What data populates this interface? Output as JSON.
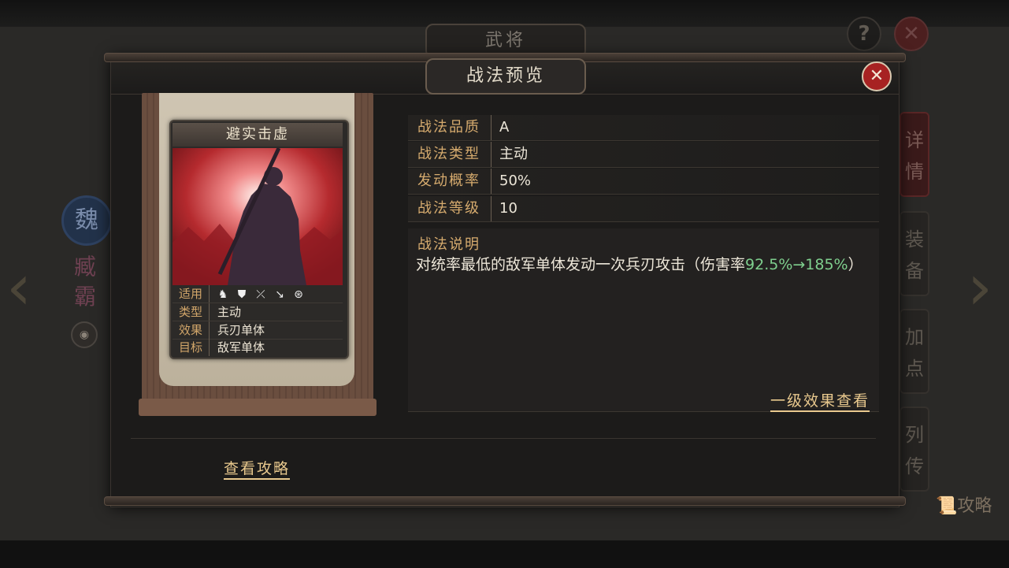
{
  "background": {
    "title": "武将",
    "help_label": "?",
    "close_label": "✕",
    "faction": "魏",
    "hero_name": "臧霸",
    "side_tabs": [
      "详情",
      "装备",
      "加点",
      "列传"
    ],
    "guide_label": "攻略"
  },
  "modal": {
    "title": "战法预览",
    "close_label": "✕",
    "card": {
      "name": "避实击虚",
      "rows": [
        {
          "key": "适用",
          "value": ""
        },
        {
          "key": "类型",
          "value": "主动"
        },
        {
          "key": "效果",
          "value": "兵刃单体"
        },
        {
          "key": "目标",
          "value": "敌军单体"
        }
      ],
      "unit_icons": [
        "cavalry-icon",
        "shield-icon",
        "bow-icon",
        "spear-icon",
        "siege-icon"
      ]
    },
    "attributes": [
      {
        "key": "战法品质",
        "value": "A"
      },
      {
        "key": "战法类型",
        "value": "主动"
      },
      {
        "key": "发动概率",
        "value": "50%"
      },
      {
        "key": "战法等级",
        "value": "10"
      }
    ],
    "description_title": "战法说明",
    "description_prefix": "对统率最低的敌军单体发动一次兵刃攻击（伤害率",
    "description_highlight": "92.5%→185%",
    "description_suffix": "）",
    "level_effect_link": "一级效果查看",
    "guide_link": "查看攻略"
  },
  "colors": {
    "accent_gold": "#d6ab6e",
    "highlight_green": "#7fcf8e",
    "close_red": "#a72222"
  }
}
